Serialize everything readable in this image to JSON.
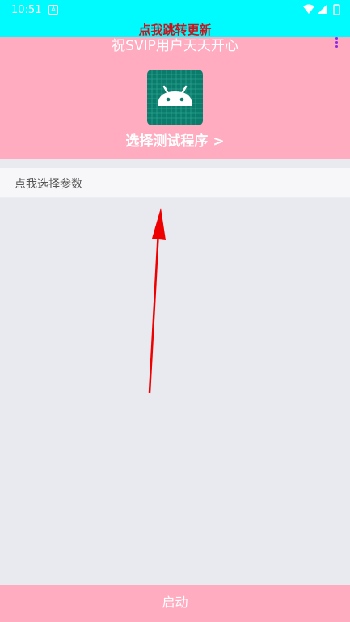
{
  "status_bar": {
    "time": "10:51",
    "notification_icon": "android-notification-icon",
    "icons": [
      "wifi-icon",
      "signal-icon",
      "battery-icon"
    ],
    "background": "#00fbfe"
  },
  "update_banner": {
    "text": "点我跳转更新",
    "color": "#c8141c"
  },
  "header": {
    "title": "祝SVIP用户天天开心",
    "menu_icon": "overflow-menu-icon",
    "app_icon": "android-app-icon",
    "choose_program_label": "选择测试程序 >",
    "background": "#ffabc0"
  },
  "params": {
    "label": "点我选择参数"
  },
  "annotation": {
    "arrow": "red-arrow-icon",
    "color": "#ee0000"
  },
  "footer": {
    "start_label": "启动"
  }
}
